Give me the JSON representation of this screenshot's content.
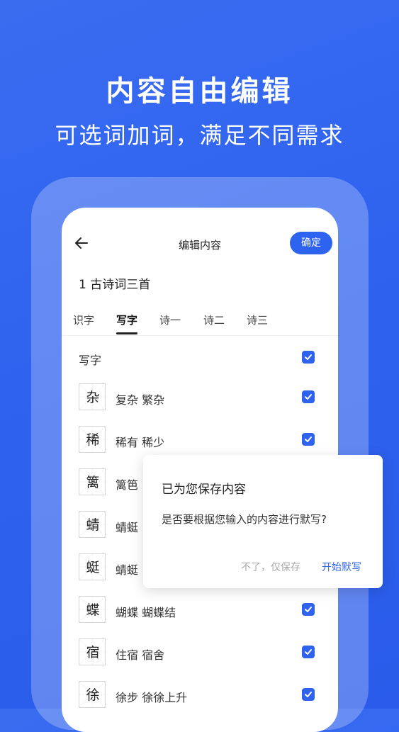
{
  "promo": {
    "headline": "内容自由编辑",
    "subline": "可选词加词，满足不同需求"
  },
  "topbar": {
    "title": "编辑内容",
    "confirm_label": "确定"
  },
  "lesson": {
    "title": "1 古诗词三首"
  },
  "tabs": [
    {
      "label": "识字"
    },
    {
      "label": "写字"
    },
    {
      "label": "诗一"
    },
    {
      "label": "诗二"
    },
    {
      "label": "诗三"
    }
  ],
  "section": {
    "label": "写字"
  },
  "rows": [
    {
      "char": "杂",
      "words": "复杂  繁杂"
    },
    {
      "char": "稀",
      "words": "稀有  稀少"
    },
    {
      "char": "篱",
      "words": "篱笆"
    },
    {
      "char": "蜻",
      "words": "蜻蜓"
    },
    {
      "char": "蜓",
      "words": "蜻蜓"
    },
    {
      "char": "蝶",
      "words": "蝴蝶  蝴蝶结"
    },
    {
      "char": "宿",
      "words": "住宿  宿舍"
    },
    {
      "char": "徐",
      "words": "徐步  徐徐上升"
    }
  ],
  "dialog": {
    "title": "已为您保存内容",
    "message": "是否要根据您输入的内容进行默写?",
    "cancel_label": "不了，仅保存",
    "ok_label": "开始默写"
  },
  "colors": {
    "accent": "#2d63ee",
    "background": "#3166ef"
  }
}
